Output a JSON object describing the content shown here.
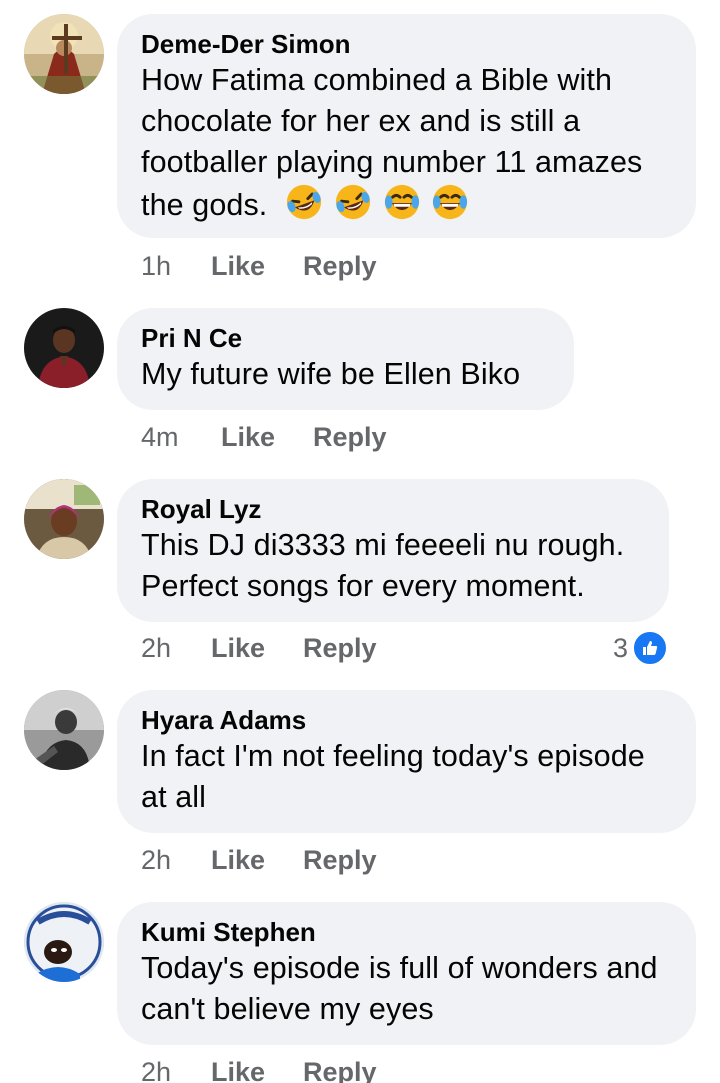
{
  "comments": [
    {
      "author": "Deme-Der Simon",
      "text": "How Fatima combined a Bible with chocolate for her ex and is still a footballer playing number 11 amazes the gods.",
      "emoji": [
        "rolling-on-floor-laughing",
        "rolling-on-floor-laughing",
        "tears-of-joy",
        "tears-of-joy"
      ],
      "time": "1h",
      "like_label": "Like",
      "reply_label": "Reply"
    },
    {
      "author": "Pri N Ce",
      "text": "My future wife be Ellen Biko",
      "time": "4m",
      "like_label": "Like",
      "reply_label": "Reply"
    },
    {
      "author": "Royal Lyz",
      "text": "This DJ di3333 mi feeeeli nu rough. Perfect songs for every moment.",
      "time": "2h",
      "like_label": "Like",
      "reply_label": "Reply",
      "reaction_count": "3",
      "reaction_icon": "like-icon"
    },
    {
      "author": "Hyara Adams",
      "text": "In fact I'm not feeling today's episode at all",
      "time": "2h",
      "like_label": "Like",
      "reply_label": "Reply"
    },
    {
      "author": "Kumi Stephen",
      "text": "Today's episode is full of wonders and can't believe my eyes",
      "time": "2h",
      "like_label": "Like",
      "reply_label": "Reply"
    }
  ],
  "colors": {
    "bubble": "#f0f2f5",
    "meta": "#65676b",
    "like_blue": "#1877f2",
    "emoji_yellow": "#f7b519"
  }
}
